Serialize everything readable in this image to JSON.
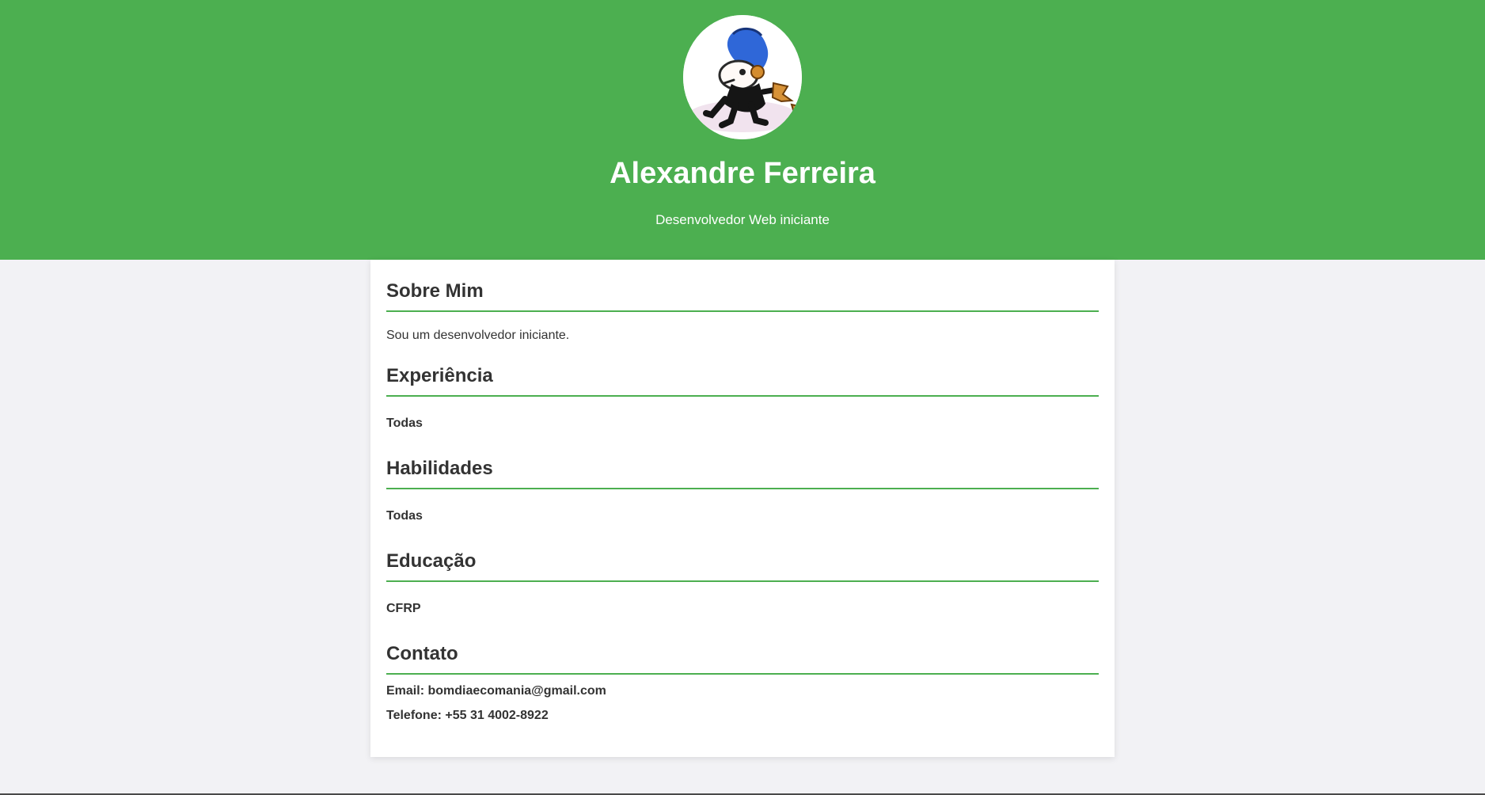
{
  "header": {
    "name": "Alexandre Ferreira",
    "subtitle": "Desenvolvedor Web iniciante",
    "avatar_icon": "cartoon-character-avatar"
  },
  "sections": {
    "about": {
      "title": "Sobre Mim",
      "text": "Sou um desenvolvedor iniciante."
    },
    "experience": {
      "title": "Experiência",
      "text": "Todas"
    },
    "skills": {
      "title": "Habilidades",
      "text": "Todas"
    },
    "education": {
      "title": "Educação",
      "text": "CFRP"
    },
    "contact": {
      "title": "Contato",
      "email": "Email: bomdiaecomania@gmail.com",
      "phone": "Telefone: +55 31 4002-8922"
    }
  },
  "colors": {
    "accent": "#4caf50",
    "background": "#f2f2f5",
    "card": "#ffffff",
    "text": "#333333"
  }
}
